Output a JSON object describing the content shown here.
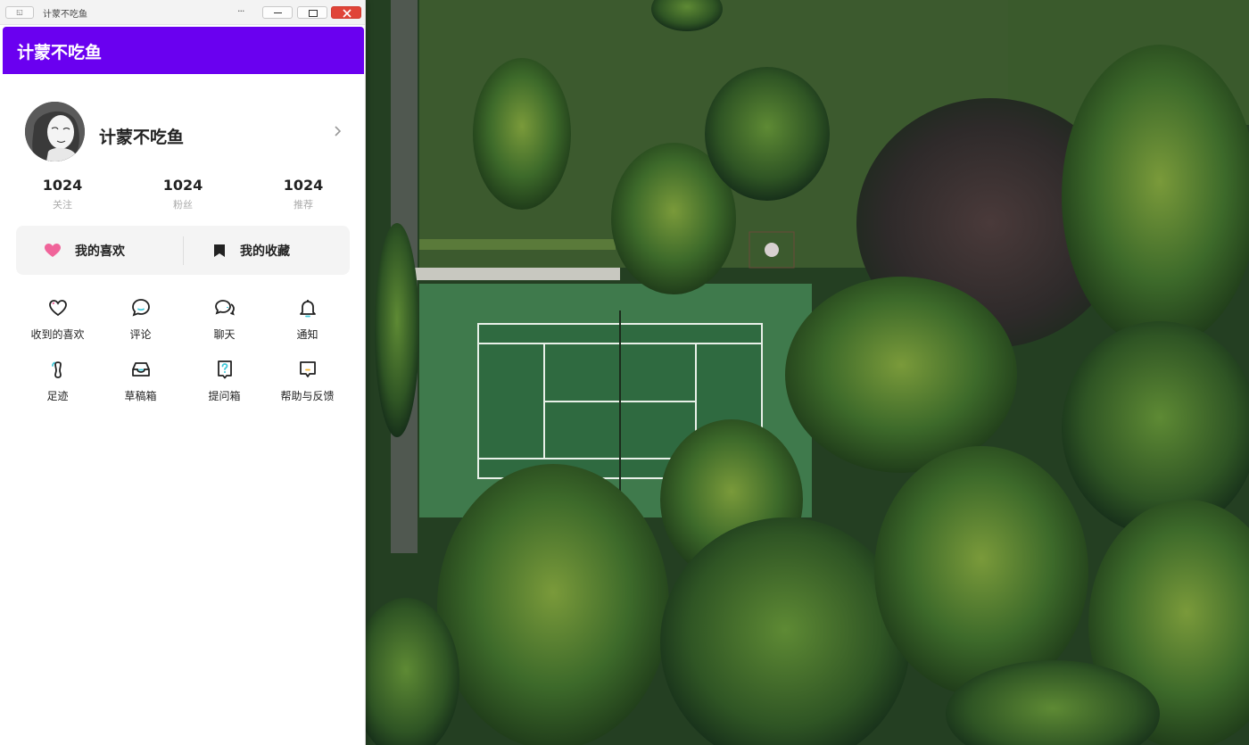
{
  "window": {
    "title": "计蒙不吃鱼",
    "more_label": "···",
    "app_icon_glyph": "◱"
  },
  "appbar": {
    "title": "计蒙不吃鱼",
    "color": "#6a00f0"
  },
  "profile": {
    "name": "计蒙不吃鱼"
  },
  "stats": [
    {
      "value": "1024",
      "label": "关注"
    },
    {
      "value": "1024",
      "label": "粉丝"
    },
    {
      "value": "1024",
      "label": "推荐"
    }
  ],
  "likes_panel": {
    "likes_label": "我的喜欢",
    "likes_icon": "heart-icon",
    "likes_icon_color": "#f0649a",
    "collect_label": "我的收藏",
    "collect_icon": "bookmark-icon"
  },
  "grid": [
    {
      "label": "收到的喜欢",
      "icon": "heart-outline-icon"
    },
    {
      "label": "评论",
      "icon": "comment-icon"
    },
    {
      "label": "聊天",
      "icon": "chat-icon"
    },
    {
      "label": "通知",
      "icon": "bell-icon"
    },
    {
      "label": "足迹",
      "icon": "footprint-icon"
    },
    {
      "label": "草稿箱",
      "icon": "inbox-icon"
    },
    {
      "label": "提问箱",
      "icon": "question-box-icon"
    },
    {
      "label": "帮助与反馈",
      "icon": "feedback-icon"
    }
  ],
  "accent_color": "#3ec7d8"
}
